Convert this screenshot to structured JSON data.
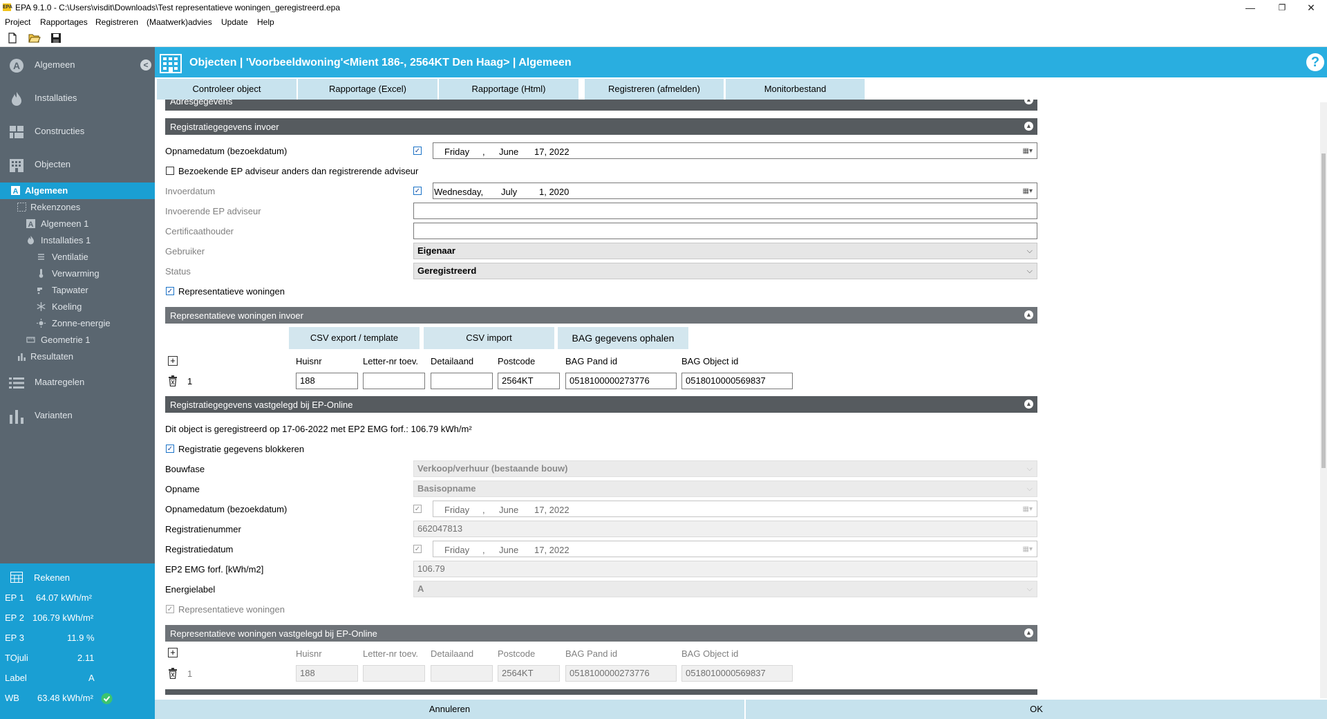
{
  "window": {
    "logo": "EPA",
    "title": "EPA 9.1.0 - C:\\Users\\visdit\\Downloads\\Test representatieve woningen_geregistreerd.epa",
    "controls": [
      "—",
      "❐",
      "✕"
    ]
  },
  "menu": [
    "Project",
    "Rapportages",
    "Registreren",
    "(Maatwerk)advies",
    "Update",
    "Help"
  ],
  "sidebar": {
    "main": [
      {
        "label": "Algemeen",
        "icon": "algemeen-icon"
      },
      {
        "label": "Installaties",
        "icon": "flame-icon"
      },
      {
        "label": "Constructies",
        "icon": "bricks-icon"
      },
      {
        "label": "Objecten",
        "icon": "building-icon"
      }
    ],
    "objecten_items": [
      {
        "label": "Algemeen",
        "icon": "letter-a-icon",
        "active": true
      },
      {
        "label": "Rekenzones",
        "icon": "zones-icon"
      },
      {
        "label": "Algemeen 1",
        "icon": "letter-a-icon"
      },
      {
        "label": "Installaties 1",
        "icon": "flame-icon"
      },
      {
        "label": "Ventilatie",
        "icon": "fan-icon"
      },
      {
        "label": "Verwarming",
        "icon": "thermometer-icon"
      },
      {
        "label": "Tapwater",
        "icon": "tap-icon"
      },
      {
        "label": "Koeling",
        "icon": "snowflake-icon"
      },
      {
        "label": "Zonne-energie",
        "icon": "sun-icon"
      },
      {
        "label": "Geometrie 1",
        "icon": "ruler-icon"
      },
      {
        "label": "Resultaten",
        "icon": "bar-chart-icon"
      }
    ],
    "bottom": [
      {
        "label": "Maatregelen",
        "icon": "list-icon"
      },
      {
        "label": "Varianten",
        "icon": "bar-chart-icon"
      }
    ],
    "collapse_glyph": "<"
  },
  "results": {
    "title": "Rekenen",
    "rows": [
      {
        "key": "EP 1",
        "value": "64.07 kWh/m²"
      },
      {
        "key": "EP 2",
        "value": "106.79 kWh/m²"
      },
      {
        "key": "EP 3",
        "value": "11.9 %"
      },
      {
        "key": "TOjuli",
        "value": "2.11"
      },
      {
        "key": "Label",
        "value": "A"
      },
      {
        "key": "WB",
        "value": "63.48 kWh/m²"
      }
    ]
  },
  "header": {
    "title": "Objecten | 'Voorbeeldwoning'<Mient 186-, 2564KT Den Haag> | Algemeen",
    "help": "?"
  },
  "tabs": [
    "Controleer object",
    "Rapportage (Excel)",
    "Rapportage (Html)",
    "Registreren (afmelden)",
    "Monitorbestand"
  ],
  "sections": {
    "adres": "Adresgegevens",
    "invoer": "Registratiegegevens invoer",
    "rep_invoer": "Representatieve woningen invoer",
    "vastgelegd": "Registratiegegevens vastgelegd bij EP-Online",
    "rep_vastgelegd": "Representatieve woningen vastgelegd bij EP-Online"
  },
  "invoer": {
    "opnamedatum": {
      "label": "Opnamedatum (bezoekdatum)",
      "checked": true,
      "day": "Friday",
      "sep": ",",
      "month": "June",
      "date": "17, 2022"
    },
    "bezoekende": {
      "label": "Bezoekende EP adviseur anders dan registrerende adviseur",
      "checked": false
    },
    "invoerdatum": {
      "label": "Invoerdatum",
      "checked": true,
      "day": "Wednesday,",
      "month": "July",
      "date": "1, 2020"
    },
    "invoerende": {
      "label": "Invoerende  EP adviseur",
      "value": ""
    },
    "certificaat": {
      "label": "Certificaathouder",
      "value": ""
    },
    "gebruiker": {
      "label": "Gebruiker",
      "value": "Eigenaar"
    },
    "status": {
      "label": "Status",
      "value": "Geregistreerd"
    },
    "representatief": {
      "label": "Representatieve woningen",
      "checked": true
    }
  },
  "rep_invoer": {
    "buttons": [
      "CSV export / template",
      "CSV import",
      "BAG gegevens ophalen"
    ],
    "columns": [
      "Huisnr",
      "Letter-nr toev.",
      "Detailaand",
      "Postcode",
      "BAG Pand id",
      "BAG Object id"
    ],
    "rows": [
      {
        "index": "1",
        "huisnr": "188",
        "letter": "",
        "detail": "",
        "postcode": "2564KT",
        "pand": "0518100000273776",
        "object": "0518010000569837"
      }
    ]
  },
  "vastgelegd": {
    "info": "Dit object is geregistreerd op 17-06-2022 met EP2 EMG forf.: 106.79 kWh/m²",
    "blokkeren": {
      "label": "Registratie gegevens blokkeren",
      "checked": true
    },
    "bouwfase": {
      "label": "Bouwfase",
      "value": "Verkoop/verhuur (bestaande bouw)"
    },
    "opname": {
      "label": "Opname",
      "value": "Basisopname"
    },
    "opnamedatum": {
      "label": "Opnamedatum (bezoekdatum)",
      "checked": true,
      "day": "Friday",
      "sep": ",",
      "month": "June",
      "date": "17, 2022"
    },
    "registratienummer": {
      "label": "Registratienummer",
      "value": "662047813"
    },
    "registratiedatum": {
      "label": "Registratiedatum",
      "checked": true,
      "day": "Friday",
      "sep": ",",
      "month": "June",
      "date": "17, 2022"
    },
    "ep2": {
      "label": "EP2 EMG forf. [kWh/m2]",
      "value": "106.79"
    },
    "energielabel": {
      "label": "Energielabel",
      "value": "A"
    },
    "representatief": {
      "label": "Representatieve woningen",
      "checked": true
    }
  },
  "rep_vastgelegd": {
    "columns": [
      "Huisnr",
      "Letter-nr toev.",
      "Detailaand",
      "Postcode",
      "BAG Pand id",
      "BAG Object id"
    ],
    "rows": [
      {
        "index": "1",
        "huisnr": "188",
        "letter": "",
        "detail": "",
        "postcode": "2564KT",
        "pand": "0518100000273776",
        "object": "0518010000569837"
      }
    ]
  },
  "footer": {
    "cancel": "Annuleren",
    "ok": "OK"
  }
}
